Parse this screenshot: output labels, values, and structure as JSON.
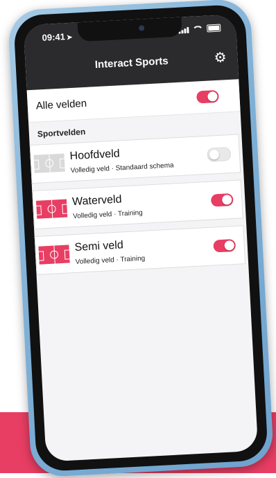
{
  "status": {
    "time": "09:41"
  },
  "nav": {
    "title": "Interact Sports"
  },
  "all_fields": {
    "label": "Alle velden",
    "enabled": true
  },
  "section": {
    "title": "Sportvelden"
  },
  "fields": [
    {
      "name": "Hoofdveld",
      "subtitle": "Volledig veld · Standaard schema",
      "enabled": false
    },
    {
      "name": "Waterveld",
      "subtitle": "Volledig veld · Training",
      "enabled": true
    },
    {
      "name": "Semi veld",
      "subtitle": "Volledig veld · Training",
      "enabled": true
    }
  ],
  "colors": {
    "accent": "#e83e63",
    "navbar": "#2b2b2d",
    "frame": "#7fb0d6"
  },
  "icons": {
    "settings": "gear-icon",
    "field": "soccer-field-icon"
  }
}
